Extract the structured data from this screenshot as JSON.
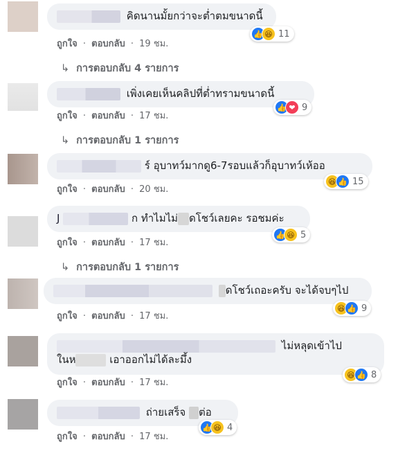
{
  "labels": {
    "like": "ถูกใจ",
    "reply": "ตอบกลับ",
    "dot": "·",
    "reply_arrow": "↳"
  },
  "comments": [
    {
      "avatar_color": "#ddd0c8",
      "text": "คิดนานมั้ยกว่าจะต่ำตมขนาดนี้",
      "reactions": [
        "like",
        "haha"
      ],
      "reaction_count": "11",
      "time": "19 ชม.",
      "replies": "การตอบกลับ 4 รายการ"
    },
    {
      "avatar_color": "#e6e6e6",
      "text": "เพิ่งเคยเห็นคลิปที่ต่ำทรามขนาดนี้",
      "reactions": [
        "like",
        "love"
      ],
      "reaction_count": "9",
      "time": "17 ชม.",
      "replies": "การตอบกลับ 1 รายการ"
    },
    {
      "avatar_color": "#b3a59d",
      "text": "ร์ อุบาทว์มากดู6-7รอบแล้วก็อุบาทว์เห้ออ",
      "reactions": [
        "haha",
        "like"
      ],
      "reaction_count": "15",
      "time": "20 ชม.",
      "replies": ""
    },
    {
      "avatar_color": "#dcdcdc",
      "text_prefix": "J",
      "text_mid": "ก ทำไมไม่",
      "text": "ดโชว์เลยคะ รอชมค่ะ",
      "reactions": [
        "like",
        "haha"
      ],
      "reaction_count": "5",
      "time": "17 ชม.",
      "replies": "การตอบกลับ 1 รายการ"
    },
    {
      "avatar_color": "#c3bab6",
      "text": "ดโชว์เถอะครับ จะได้จบๆไป",
      "reactions": [
        "haha",
        "like"
      ],
      "reaction_count": "9",
      "time": "17 ชม.",
      "replies": ""
    },
    {
      "avatar_color": "#a9a29e",
      "text": "ไม่หลุดเข้าไป",
      "text_line2_prefix": "ในห",
      "text_line2": "เอาออกไม่ได้ละมึ้ง",
      "reactions": [
        "haha",
        "like"
      ],
      "reaction_count": "8",
      "time": "17 ชม.",
      "replies": ""
    },
    {
      "avatar_color": "#a6a4a4",
      "text_mid": "ถ่ายเสร็จ",
      "text": "ต่อ",
      "reactions": [
        "like",
        "haha"
      ],
      "reaction_count": "4",
      "time": "17 ชม.",
      "replies": ""
    }
  ]
}
